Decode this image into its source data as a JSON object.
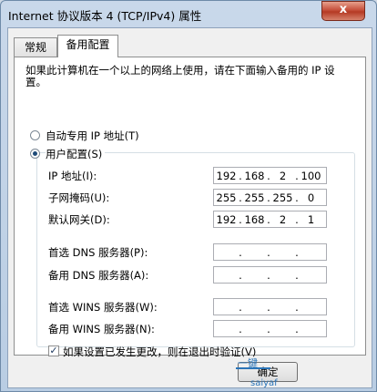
{
  "window": {
    "title": "Internet 协议版本 4 (TCP/IPv4) 属性",
    "close_glyph": "x"
  },
  "tabs": [
    {
      "label": "常规"
    },
    {
      "label": "备用配置"
    }
  ],
  "description": "如果此计算机在一个以上的网络上使用，请在下面输入备用的 IP 设置。",
  "radios": {
    "auto": {
      "label": "自动专用 IP 地址(T)"
    },
    "user": {
      "label": "用户配置(S)"
    }
  },
  "fields": {
    "ip": {
      "label": "IP 地址(I):",
      "octets": [
        "192",
        "168",
        "2",
        "100"
      ]
    },
    "mask": {
      "label": "子网掩码(U):",
      "octets": [
        "255",
        "255",
        "255",
        "0"
      ]
    },
    "gateway": {
      "label": "默认网关(D):",
      "octets": [
        "192",
        "168",
        "2",
        "1"
      ]
    },
    "dns1": {
      "label": "首选 DNS 服务器(P):"
    },
    "dns2": {
      "label": "备用 DNS 服务器(A):"
    },
    "wins1": {
      "label": "首选 WINS 服务器(W):"
    },
    "wins2": {
      "label": "备用 WINS 服务器(N):"
    }
  },
  "checkbox": {
    "label": "如果设置已发生更改，则在退出时验证(V)",
    "checked": true,
    "mark": "✓"
  },
  "buttons": {
    "ok": "确定"
  },
  "watermark": {
    "text1": "一键",
    "text2": "saiyaf"
  },
  "dot": "."
}
